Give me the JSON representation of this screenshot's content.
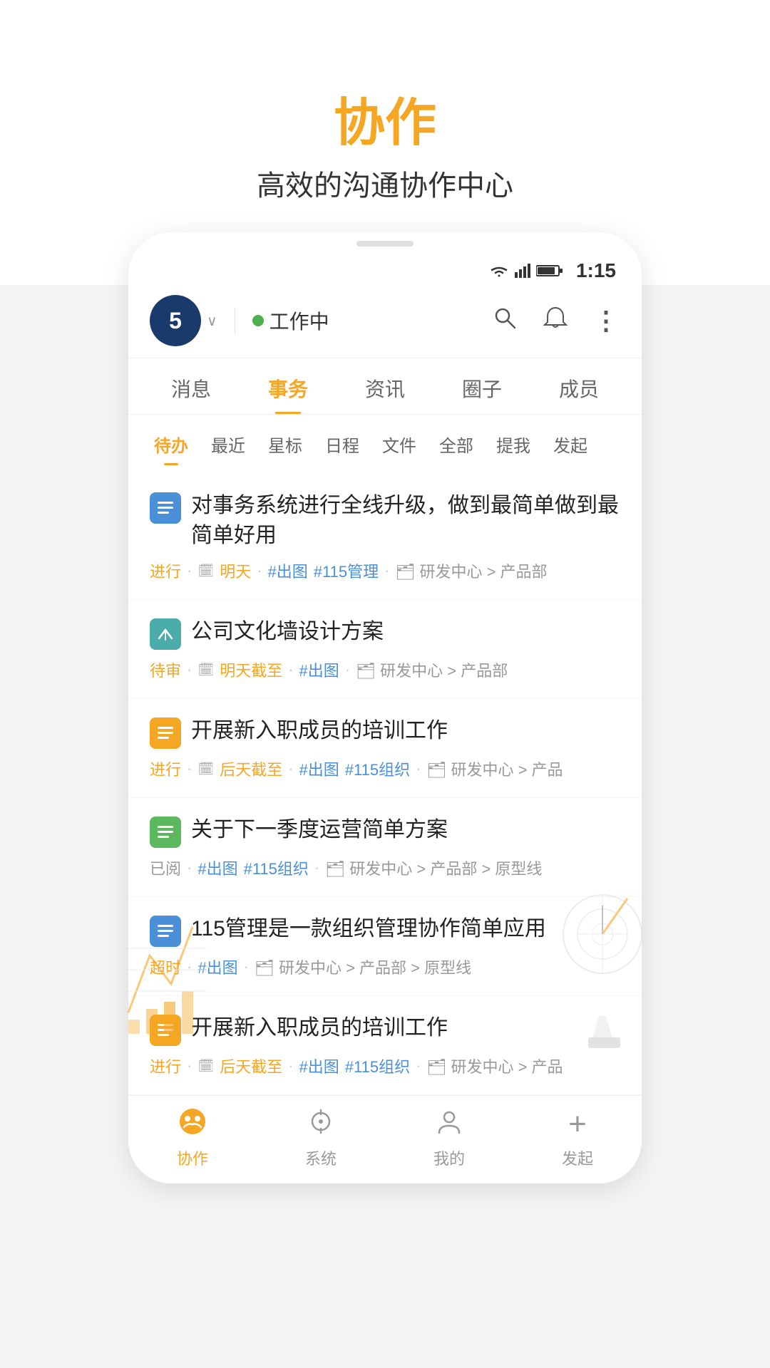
{
  "page": {
    "background": "#f5f5f5"
  },
  "header": {
    "title": "协作",
    "subtitle": "高效的沟通协作中心"
  },
  "statusBar": {
    "time": "1:15"
  },
  "appHeader": {
    "avatar": "5",
    "dropdownArrow": "∨",
    "statusDot": "green",
    "statusText": "工作中",
    "searchIcon": "🔍",
    "bellIcon": "🔔",
    "moreIcon": "⋮"
  },
  "mainTabs": [
    {
      "id": "messages",
      "label": "消息",
      "active": false
    },
    {
      "id": "tasks",
      "label": "事务",
      "active": true
    },
    {
      "id": "news",
      "label": "资讯",
      "active": false
    },
    {
      "id": "circle",
      "label": "圈子",
      "active": false
    },
    {
      "id": "members",
      "label": "成员",
      "active": false
    }
  ],
  "filterTabs": [
    {
      "id": "pending",
      "label": "待办",
      "active": true
    },
    {
      "id": "recent",
      "label": "最近",
      "active": false
    },
    {
      "id": "starred",
      "label": "星标",
      "active": false
    },
    {
      "id": "schedule",
      "label": "日程",
      "active": false
    },
    {
      "id": "files",
      "label": "文件",
      "active": false
    },
    {
      "id": "all",
      "label": "全部",
      "active": false
    },
    {
      "id": "mentioned",
      "label": "提我",
      "active": false
    },
    {
      "id": "started",
      "label": "发起",
      "active": false
    }
  ],
  "tasks": [
    {
      "id": 1,
      "iconType": "blue",
      "iconSymbol": "≡",
      "title": "对事务系统进行全线升级，做到最简单做到最简单好用",
      "status": "进行",
      "statusType": "active",
      "date": "明天",
      "datePrefix": "🗓",
      "tags": [
        "#出图",
        "#115管理"
      ],
      "path": [
        "研发中心",
        "产品部"
      ]
    },
    {
      "id": 2,
      "iconType": "teal",
      "iconSymbol": "↗",
      "title": "公司文化墙设计方案",
      "status": "待审",
      "statusType": "pending",
      "date": "明天截至",
      "datePrefix": "🗓",
      "tags": [
        "#出图"
      ],
      "path": [
        "研发中心",
        "产品部"
      ]
    },
    {
      "id": 3,
      "iconType": "orange",
      "iconSymbol": "≡",
      "title": "开展新入职成员的培训工作",
      "status": "进行",
      "statusType": "active",
      "date": "后天截至",
      "datePrefix": "🗓",
      "tags": [
        "#出图",
        "#115组织"
      ],
      "path": [
        "研发中心",
        "产品"
      ]
    },
    {
      "id": 4,
      "iconType": "green",
      "iconSymbol": "≡",
      "title": "关于下一季度运营简单方案",
      "status": "已阅",
      "statusType": "read",
      "date": "",
      "datePrefix": "",
      "tags": [
        "#出图",
        "#115组织"
      ],
      "path": [
        "研发中心",
        "产品部",
        "原型线"
      ]
    },
    {
      "id": 5,
      "iconType": "blue",
      "iconSymbol": "≡",
      "title": "115管理是一款组织管理协作简单应用",
      "status": "超时",
      "statusType": "overdue",
      "date": "",
      "datePrefix": "",
      "tags": [
        "#出图"
      ],
      "path": [
        "研发中心",
        "产品部",
        "原型线"
      ]
    },
    {
      "id": 6,
      "iconType": "orange",
      "iconSymbol": "≡",
      "title": "开展新入职成员的培训工作",
      "status": "进行",
      "statusType": "active",
      "date": "后天截至",
      "datePrefix": "🗓",
      "tags": [
        "#出图",
        "#115组织"
      ],
      "path": [
        "研发中心",
        "产品"
      ]
    }
  ],
  "bottomNav": [
    {
      "id": "collab",
      "label": "协作",
      "active": true,
      "icon": "😊"
    },
    {
      "id": "system",
      "label": "系统",
      "active": false,
      "icon": "⊕"
    },
    {
      "id": "mine",
      "label": "我的",
      "active": false,
      "icon": "👤"
    },
    {
      "id": "start",
      "label": "发起",
      "active": false,
      "icon": "+"
    }
  ]
}
